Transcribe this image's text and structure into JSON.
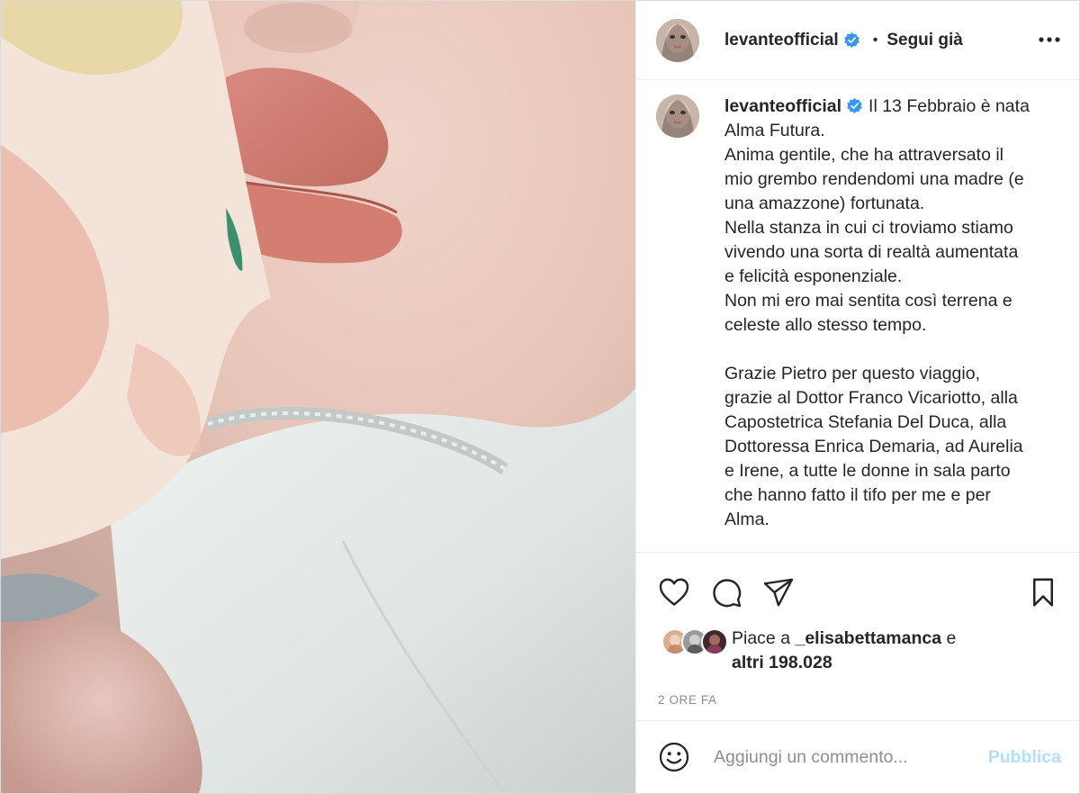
{
  "post": {
    "username": "levanteofficial",
    "follow_label": "Segui già",
    "separator": "•",
    "caption_lines": [
      "Il 13 Febbraio è nata",
      "Alma Futura.",
      "Anima gentile, che ha attraversato il",
      "mio grembo rendendomi una madre (e",
      "una amazzone) fortunata.",
      "Nella stanza in cui ci troviamo stiamo",
      "vivendo una sorta di realtà aumentata",
      "e felicità esponenziale.",
      "Non mi ero mai sentita così terrena e",
      "celeste allo stesso tempo.",
      "",
      "Grazie Pietro per questo viaggio,",
      "grazie al Dottor Franco Vicariotto, alla",
      "Capostetrica Stefania Del Duca, alla",
      "Dottoressa Enrica Demaria, ad Aurelia",
      "e Irene, a tutte le donne in sala parto",
      "che hanno fatto il tifo per me e per",
      "Alma."
    ],
    "likes_prefix": "Piace a",
    "liked_by_user": "_elisabettamanca",
    "likes_and": "e",
    "likes_others": "altri 198.028",
    "timestamp": "2 ORE FA",
    "comment_placeholder": "Aggiungi un commento...",
    "publish_label": "Pubblica"
  },
  "icons": {
    "verified": "verified-badge-icon",
    "more": "more-options-icon",
    "like": "heart-icon",
    "comment": "comment-icon",
    "share": "paper-plane-icon",
    "save": "bookmark-icon",
    "emoji": "smiley-icon"
  },
  "colors": {
    "text": "#262626",
    "muted": "#8e8e8e",
    "verified_blue": "#3897f0",
    "publish_disabled": "#b2dffc",
    "border": "#efefef"
  }
}
